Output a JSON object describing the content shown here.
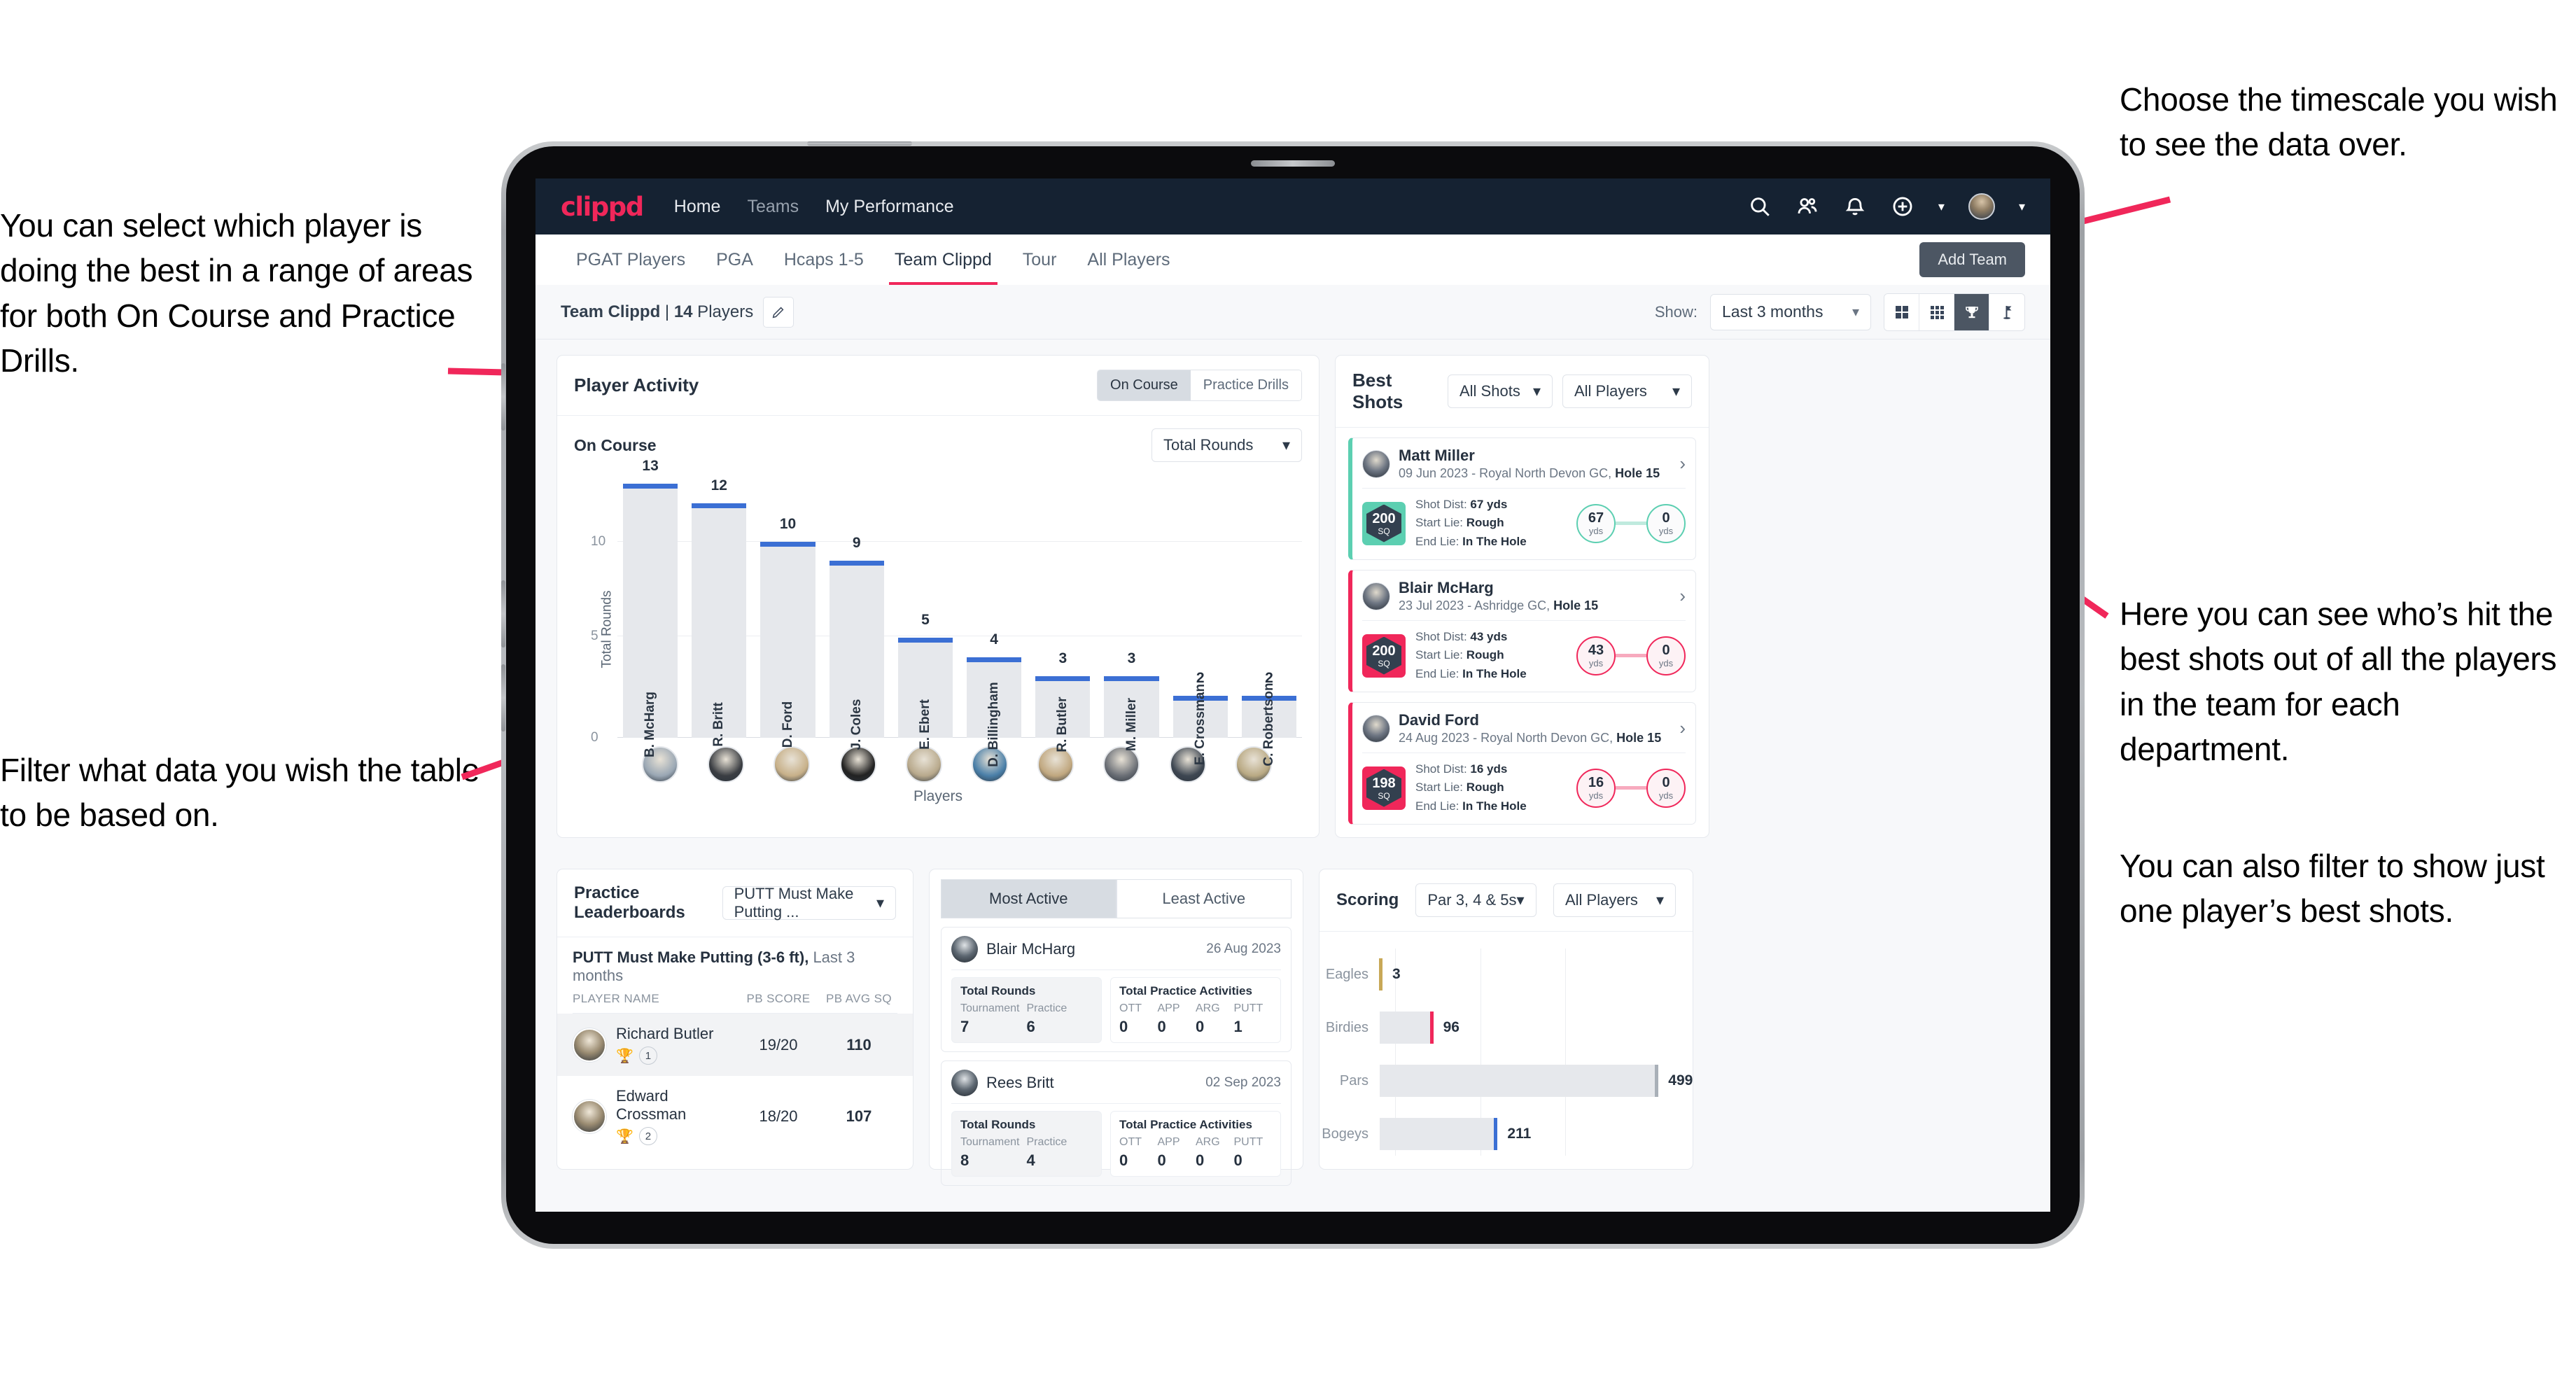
{
  "annotations": {
    "left_top": "You can select which player is doing the best in a range of areas for both On Course and Practice Drills.",
    "left_bottom": "Filter what data you wish the table to be based on.",
    "right_top": "Choose the timescale you wish to see the data over.",
    "right_middle": "Here you can see who’s hit the best shots out of all the players in the team for each department.",
    "right_bottom": "You can also filter to show just one player’s best shots."
  },
  "topnav": {
    "logo": "clippd",
    "links": [
      "Home",
      "Teams",
      "My Performance"
    ],
    "icons": [
      "search-icon",
      "people-icon",
      "bell-icon",
      "plus-circle-icon",
      "avatar"
    ]
  },
  "tabs": {
    "items": [
      "PGAT Players",
      "PGA",
      "Hcaps 1-5",
      "Team Clippd",
      "Tour",
      "All Players"
    ],
    "active": "Team Clippd",
    "add_team": "Add Team"
  },
  "subbar": {
    "team_name": "Team Clippd",
    "separator": " | ",
    "player_count": "14",
    "players_word": " Players",
    "show_label": "Show:",
    "timescale": "Last 3 months",
    "view_icons": [
      "grid-2x2-icon",
      "grid-3x3-icon",
      "trophy-icon",
      "flag-icon"
    ],
    "active_view": "trophy-icon"
  },
  "player_activity": {
    "title": "Player Activity",
    "segments": [
      "On Course",
      "Practice Drills"
    ],
    "active_segment": "On Course",
    "sub_label": "On Course",
    "metric_select": "Total Rounds"
  },
  "chart_data": {
    "type": "bar",
    "title": "Player Activity - On Course",
    "xlabel": "Players",
    "ylabel": "Total Rounds",
    "ylim": [
      0,
      13
    ],
    "yticks": [
      0,
      5,
      10
    ],
    "grid": true,
    "categories": [
      "B. McHarg",
      "R. Britt",
      "D. Ford",
      "J. Coles",
      "E. Ebert",
      "D. Billingham",
      "R. Butler",
      "M. Miller",
      "E. Crossman",
      "C. Robertson"
    ],
    "values": [
      13,
      12,
      10,
      9,
      5,
      4,
      3,
      3,
      2,
      2
    ],
    "bar_color": "#e6e8ec",
    "cap_color": "#3b6fd4"
  },
  "best_shots": {
    "title": "Best Shots",
    "shot_filter": "All Shots",
    "player_filter": "All Players",
    "labels": {
      "shot_dist": "Shot Dist: ",
      "start_lie": "Start Lie: ",
      "end_lie": "End Lie: ",
      "yds": "yds",
      "sq": "SQ"
    },
    "cards": [
      {
        "name": "Matt Miller",
        "meta_date": "09 Jun 2023 - Royal North Devon GC, ",
        "meta_hole": "Hole 15",
        "score": "200",
        "shot_dist": "67 yds",
        "start_lie": "Rough",
        "end_lie": "In The Hole",
        "from_val": "67",
        "to_val": "0",
        "accent": "#5ccfb1",
        "theme": "teal"
      },
      {
        "name": "Blair McHarg",
        "meta_date": "23 Jul 2023 - Ashridge GC, ",
        "meta_hole": "Hole 15",
        "score": "200",
        "shot_dist": "43 yds",
        "start_lie": "Rough",
        "end_lie": "In The Hole",
        "from_val": "43",
        "to_val": "0",
        "accent": "#f0275a",
        "theme": "pink"
      },
      {
        "name": "David Ford",
        "meta_date": "24 Aug 2023 - Royal North Devon GC, ",
        "meta_hole": "Hole 15",
        "score": "198",
        "shot_dist": "16 yds",
        "start_lie": "Rough",
        "end_lie": "In The Hole",
        "from_val": "16",
        "to_val": "0",
        "accent": "#f0275a",
        "theme": "pink"
      }
    ]
  },
  "practice_leaderboards": {
    "title": "Practice Leaderboards",
    "drill_select": "PUTT Must Make Putting ...",
    "subtitle_bold": "PUTT Must Make Putting (3-6 ft),",
    "subtitle_rest": " Last 3 months",
    "columns": [
      "PLAYER NAME",
      "PB SCORE",
      "PB AVG SQ"
    ],
    "rows": [
      {
        "name": "Richard Butler",
        "rank": "1",
        "trophy": "gold",
        "pb_score": "19/20",
        "pb_avg_sq": "110"
      },
      {
        "name": "Edward Crossman",
        "rank": "2",
        "trophy": "silver",
        "pb_score": "18/20",
        "pb_avg_sq": "107"
      }
    ]
  },
  "activity_panel": {
    "tabs": [
      "Most Active",
      "Least Active"
    ],
    "active_tab": "Most Active",
    "rounds_title": "Total Rounds",
    "rounds_cols": [
      "Tournament",
      "Practice"
    ],
    "acts_title": "Total Practice Activities",
    "acts_cols": [
      "OTT",
      "APP",
      "ARG",
      "PUTT"
    ],
    "cards": [
      {
        "name": "Blair McHarg",
        "date": "26 Aug 2023",
        "rounds": [
          "7",
          "6"
        ],
        "acts": [
          "0",
          "0",
          "0",
          "1"
        ]
      },
      {
        "name": "Rees Britt",
        "date": "02 Sep 2023",
        "rounds": [
          "8",
          "4"
        ],
        "acts": [
          "0",
          "0",
          "0",
          "0"
        ]
      }
    ]
  },
  "scoring": {
    "title": "Scoring",
    "par_filter": "Par 3, 4 & 5s",
    "player_filter": "All Players"
  },
  "scoring_chart": {
    "type": "bar",
    "orientation": "horizontal",
    "title": "Scoring",
    "categories": [
      "Eagles",
      "Birdies",
      "Pars",
      "Bogeys"
    ],
    "values": [
      3,
      96,
      499,
      211
    ],
    "xlim": [
      0,
      560
    ],
    "cap_colors": [
      "#c8a857",
      "#f0275a",
      "#a9b0b8",
      "#3b6fd4"
    ],
    "bar_color": "#e6e8ec"
  }
}
